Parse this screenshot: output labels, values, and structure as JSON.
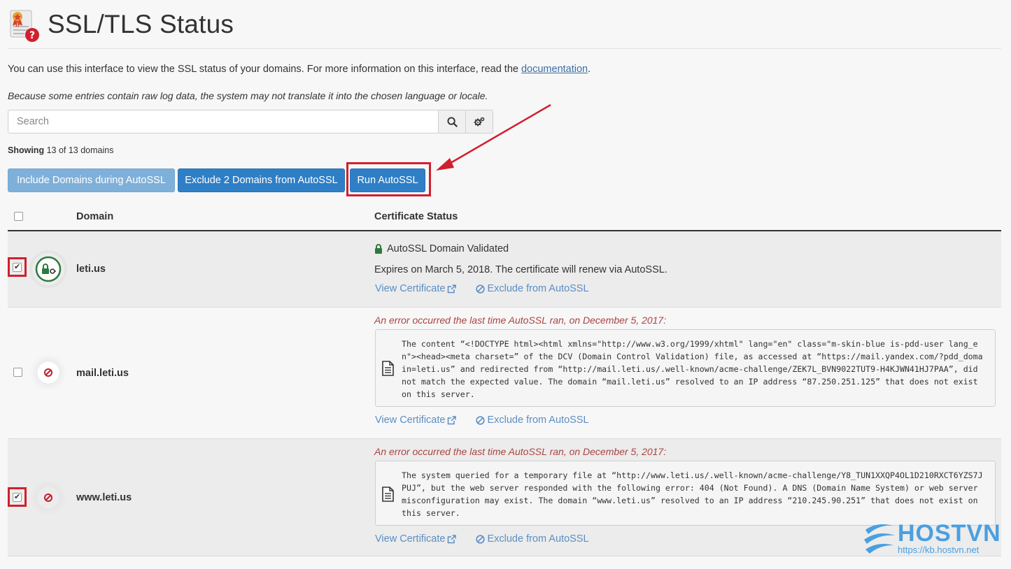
{
  "header": {
    "title": "SSL/TLS Status",
    "icon": "certificate-question-icon"
  },
  "intro": {
    "text": "You can use this interface to view the SSL status of your domains. For more information on this interface, read the ",
    "link": "documentation",
    "period": "."
  },
  "note": "Because some entries contain raw log data, the system may not translate it into the chosen language or locale.",
  "search": {
    "placeholder": "Search"
  },
  "showing": {
    "label": "Showing",
    "count": "13 of 13 domains"
  },
  "actions": {
    "include": "Include Domains during AutoSSL",
    "exclude": "Exclude 2 Domains from AutoSSL",
    "run": "Run AutoSSL"
  },
  "table": {
    "col_domain": "Domain",
    "col_status": "Certificate Status"
  },
  "rows": [
    {
      "domain": "leti.us",
      "checked": true,
      "status": "AutoSSL Domain Validated",
      "expires": "Expires on March 5, 2018. The certificate will renew via AutoSSL.",
      "view": "View Certificate",
      "exclude": "Exclude from AutoSSL"
    },
    {
      "domain": "mail.leti.us",
      "checked": false,
      "error_title": "An error occurred the last time AutoSSL ran, on December 5, 2017:",
      "error_text": "The content “<!DOCTYPE html><html xmlns=\"http://www.w3.org/1999/xhtml\" lang=\"en\" class=\"m-skin-blue is-pdd-user lang_en\"><head><meta charset=” of the DCV (Domain Control Validation) file, as accessed at “https://mail.yandex.com/?pdd_domain=leti.us” and redirected from “http://mail.leti.us/.well-known/acme-challenge/ZEK7L_BVN9022TUT9-H4KJWN41HJ7PAA”, did not match the expected value. The domain “mail.leti.us” resolved to an IP address “87.250.251.125” that does not exist on this server.",
      "view": "View Certificate",
      "exclude": "Exclude from AutoSSL"
    },
    {
      "domain": "www.leti.us",
      "checked": true,
      "error_title": "An error occurred the last time AutoSSL ran, on December 5, 2017:",
      "error_text": "The system queried for a temporary file at “http://www.leti.us/.well-known/acme-challenge/Y8_TUN1XXQP4OL1D210RXCT6YZS7JPUJ”, but the web server responded with the following error: 404 (Not Found). A DNS (Domain Name System) or web server misconfiguration may exist. The domain “www.leti.us” resolved to an IP address “210.245.90.251” that does not exist on this server.",
      "view": "View Certificate",
      "exclude": "Exclude from AutoSSL"
    }
  ],
  "watermark": {
    "brand": "HOSTVN",
    "url": "https://kb.hostvn.net"
  },
  "colors": {
    "primary": "#2f7fc6",
    "primary_light": "#7fb0d9",
    "highlight": "#d0202e",
    "error": "#a94442",
    "link": "#5b8ec4",
    "valid": "#2d7a3c"
  }
}
